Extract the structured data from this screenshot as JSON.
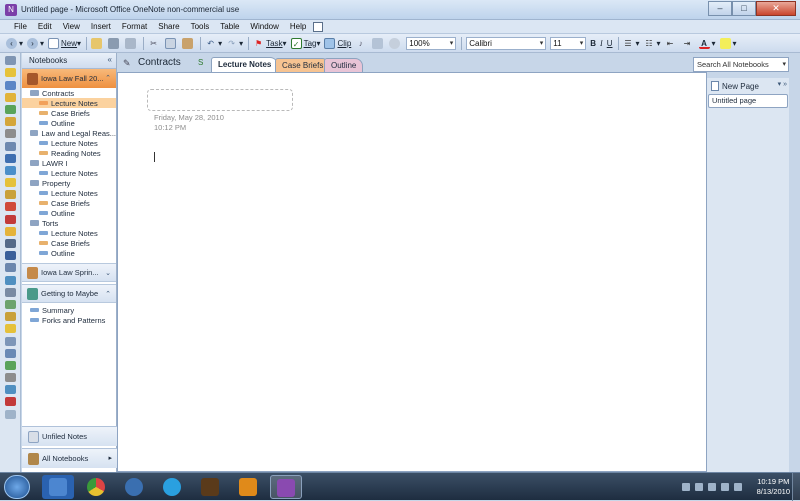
{
  "window": {
    "title": "Untitled page - Microsoft Office OneNote non-commercial use",
    "min": "–",
    "max": "□",
    "close": "✕"
  },
  "menu": [
    "File",
    "Edit",
    "View",
    "Insert",
    "Format",
    "Share",
    "Tools",
    "Table",
    "Window",
    "Help"
  ],
  "toolbar": {
    "new_label": "New",
    "task_label": "Task",
    "tag_label": "Tag",
    "clip_label": "Clip",
    "zoom": "100%",
    "font": "Calibri",
    "font_size": "11",
    "bold": "B",
    "italic": "I",
    "underline": "U"
  },
  "notebooks": {
    "header": "Notebooks",
    "active": {
      "name": "Iowa Law Fall 20...",
      "groups": [
        {
          "name": "Contracts",
          "sections": [
            {
              "name": "Lecture Notes",
              "color": "#f2a15a",
              "selected": true
            },
            {
              "name": "Case Briefs",
              "color": "#e8b16c"
            },
            {
              "name": "Outline",
              "color": "#7fa6d6"
            }
          ]
        },
        {
          "name": "Law and Legal Reas...",
          "sections": [
            {
              "name": "Lecture Notes",
              "color": "#7fa6d6"
            },
            {
              "name": "Reading Notes",
              "color": "#e8b16c"
            }
          ]
        },
        {
          "name": "LAWR I",
          "sections": [
            {
              "name": "Lecture Notes",
              "color": "#7fa6d6"
            }
          ]
        },
        {
          "name": "Property",
          "sections": [
            {
              "name": "Lecture Notes",
              "color": "#7fa6d6"
            },
            {
              "name": "Case Briefs",
              "color": "#e8b16c"
            },
            {
              "name": "Outline",
              "color": "#7fa6d6"
            }
          ]
        },
        {
          "name": "Torts",
          "sections": [
            {
              "name": "Lecture Notes",
              "color": "#7fa6d6"
            },
            {
              "name": "Case Briefs",
              "color": "#e8b16c"
            },
            {
              "name": "Outline",
              "color": "#7fa6d6"
            }
          ]
        }
      ]
    },
    "spring": "Iowa Law Sprin...",
    "maybe": {
      "name": "Getting to Maybe",
      "sections": [
        {
          "name": "Summary",
          "color": "#7fa6d6"
        },
        {
          "name": "Forks and Patterns",
          "color": "#7fa6d6"
        }
      ]
    },
    "unfiled": "Unfiled Notes",
    "all": "All Notebooks"
  },
  "section": {
    "title": "Contracts",
    "tabs": [
      {
        "label": "Lecture Notes",
        "active": true,
        "color": "#ffffff"
      },
      {
        "label": "Case Briefs",
        "active": false,
        "color": "#f6c391"
      },
      {
        "label": "Outline",
        "active": false,
        "color": "#e8c4d6"
      }
    ]
  },
  "page": {
    "date": "Friday, May 28, 2010",
    "time": "10:12 PM"
  },
  "pages_pane": {
    "search_placeholder": "Search All Notebooks",
    "new_page": "New Page",
    "pages": [
      "Untitled page"
    ]
  },
  "taskbar": {
    "time": "10:19 PM",
    "date": "8/13/2010"
  }
}
